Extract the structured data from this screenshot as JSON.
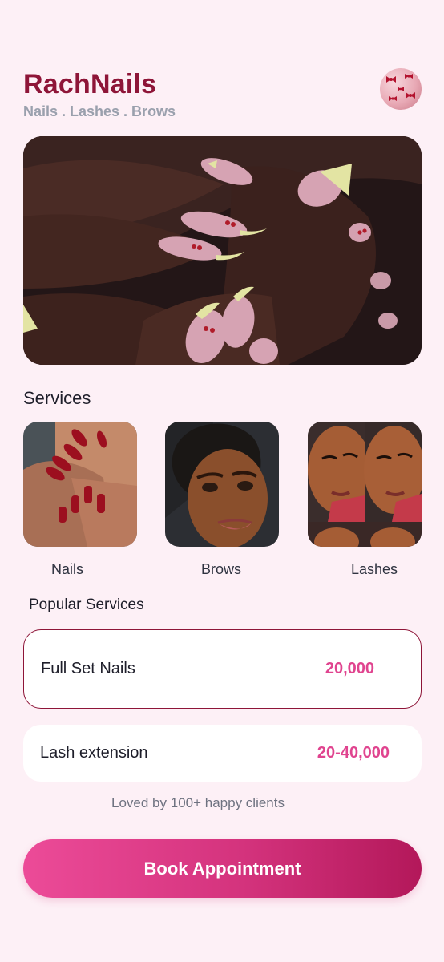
{
  "header": {
    "title": "RachNails",
    "subtitle": "Nails . Lashes . Brows"
  },
  "services": {
    "heading": "Services",
    "items": [
      {
        "label": "Nails"
      },
      {
        "label": "Brows"
      },
      {
        "label": "Lashes"
      }
    ]
  },
  "popular": {
    "heading": "Popular Services",
    "items": [
      {
        "name": "Full Set Nails",
        "price": "20,000",
        "selected": true
      },
      {
        "name": "Lash extension",
        "price": "20-40,000",
        "selected": false
      }
    ]
  },
  "footer": {
    "tagline": "Loved by 100+ happy clients",
    "book_label": "Book Appointment"
  },
  "colors": {
    "brand": "#8e1538",
    "accent": "#e0448f",
    "background": "#fdf0f6"
  }
}
